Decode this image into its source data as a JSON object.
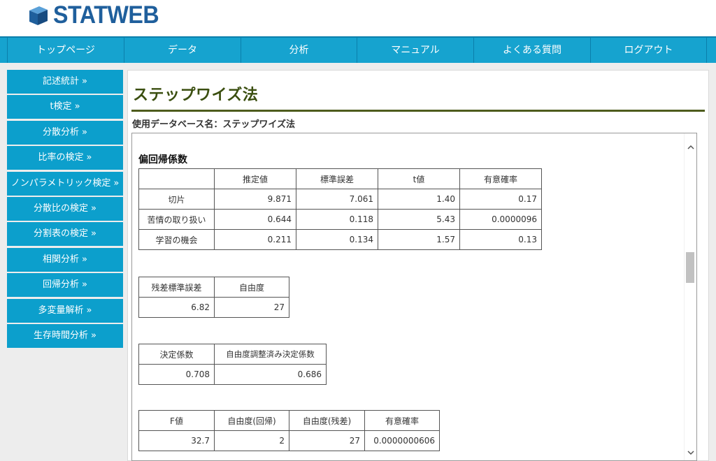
{
  "header": {
    "logo_text": "STATWEB"
  },
  "nav": {
    "items": [
      "トップページ",
      "データ",
      "分析",
      "マニュアル",
      "よくある質問",
      "ログアウト"
    ]
  },
  "sidebar": {
    "items": [
      {
        "label": "記述統計"
      },
      {
        "label": "t検定"
      },
      {
        "label": "分散分析"
      },
      {
        "label": "比率の検定"
      },
      {
        "label": "ノンパラメトリック検定"
      },
      {
        "label": "分散比の検定"
      },
      {
        "label": "分割表の検定"
      },
      {
        "label": "相関分析"
      },
      {
        "label": "回帰分析"
      },
      {
        "label": "多変量解析"
      },
      {
        "label": "生存時間分析"
      }
    ],
    "chevron": "»"
  },
  "main": {
    "title": "ステップワイズ法",
    "db_name": "使用データベース名：ステップワイズ法"
  },
  "results": {
    "coef_title": "偏回帰係数",
    "coef_headers": [
      "推定値",
      "標準誤差",
      "t値",
      "有意確率"
    ],
    "coef_rows": [
      {
        "name": "切片",
        "values": [
          "9.871",
          "7.061",
          "1.40",
          "0.17"
        ]
      },
      {
        "name": "苦情の取り扱い",
        "values": [
          "0.644",
          "0.118",
          "5.43",
          "0.0000096"
        ]
      },
      {
        "name": "学習の機会",
        "values": [
          "0.211",
          "0.134",
          "1.57",
          "0.13"
        ]
      }
    ],
    "resid_headers": [
      "残差標準誤差",
      "自由度"
    ],
    "resid_values": [
      "6.82",
      "27"
    ],
    "r2_headers": [
      "決定係数",
      "自由度調整済み決定係数"
    ],
    "r2_values": [
      "0.708",
      "0.686"
    ],
    "f_headers": [
      "F値",
      "自由度(回帰)",
      "自由度(残差)",
      "有意確率"
    ],
    "f_values": [
      "32.7",
      "2",
      "27",
      "0.0000000606"
    ]
  },
  "colors": {
    "nav_bg": "#16a3cf",
    "sidebar_bg": "#0c9fcc",
    "title_color": "#3b4f10",
    "logo_color": "#1f5f9c"
  }
}
